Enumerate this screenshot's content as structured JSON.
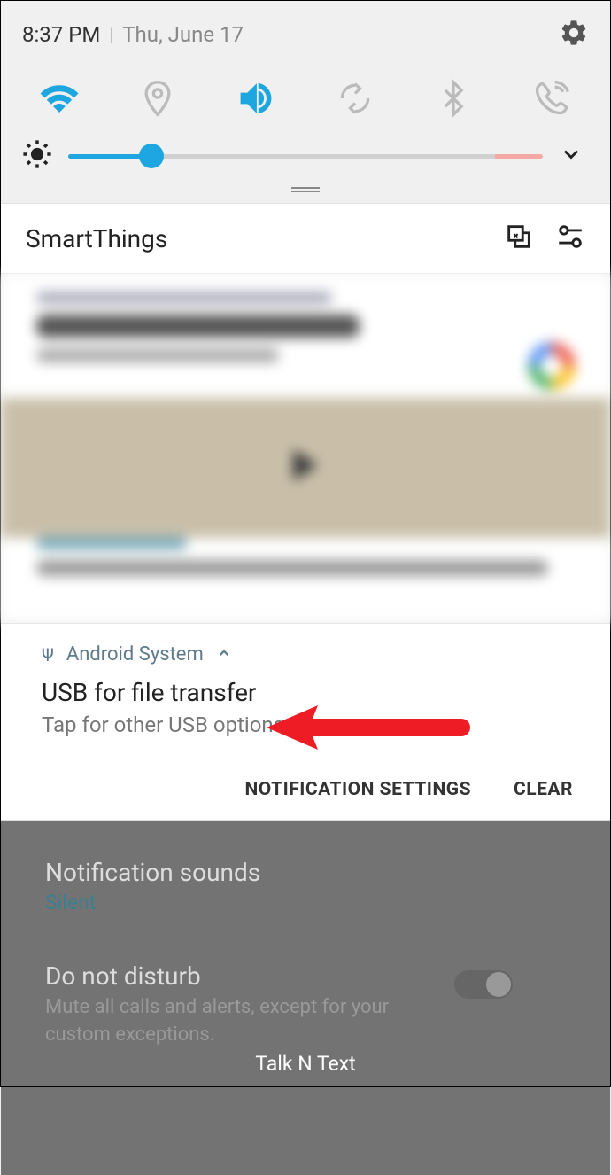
{
  "status": {
    "time": "8:37 PM",
    "date": "Thu, June 17"
  },
  "smartthings": {
    "label": "SmartThings"
  },
  "usb": {
    "app": "Android System",
    "title": "USB for file transfer",
    "subtitle": "Tap for other USB options."
  },
  "actions": {
    "settings": "NOTIFICATION SETTINGS",
    "clear": "CLEAR"
  },
  "background": {
    "sounds_title": "Notification sounds",
    "sounds_value": "Silent",
    "dnd_title": "Do not disturb",
    "dnd_sub": "Mute all calls and alerts, except for your custom exceptions."
  },
  "carrier": "Talk N Text"
}
